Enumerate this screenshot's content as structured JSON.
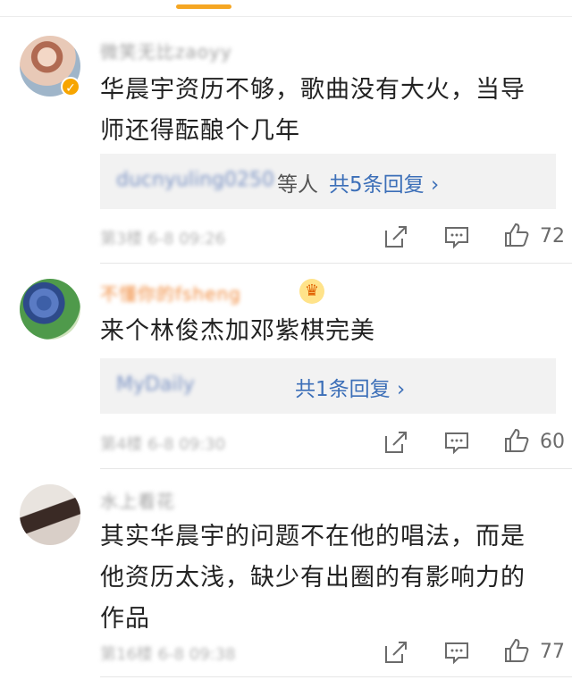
{
  "colors": {
    "accent": "#f5a623",
    "link": "#3c6fb8",
    "reply_bg": "#f2f2f2"
  },
  "comments": [
    {
      "username": "微笑无比zaoyy",
      "text_line1": "华晨宇资历不够，歌曲没有大火，当导",
      "text_line2": "师还得酝酿个几年",
      "reply_users": "ducnyuling0250",
      "reply_suffix": "等人",
      "reply_link": "共5条回复 ›",
      "meta": "第3楼 6-8 09:26",
      "likes": "72",
      "icons": [
        "verified-badge-icon",
        "share-icon",
        "comment-icon",
        "like-icon"
      ]
    },
    {
      "username": "不懂你的fsheng",
      "text_line1": "来个林俊杰加邓紫棋完美",
      "reply_users": "MyDaily",
      "reply_link": "共1条回复 ›",
      "meta": "第4楼 6-8 09:30",
      "likes": "60",
      "icons": [
        "crown-badge-icon",
        "share-icon",
        "comment-icon",
        "like-icon"
      ]
    },
    {
      "username": "水上看花",
      "text_line1": "其实华晨宇的问题不在他的唱法，而是",
      "text_line2": "他资历太浅，缺少有出圈的有影响力的",
      "text_line3": "作品",
      "meta": "第16楼 6-8 09:38",
      "likes": "77",
      "icons": [
        "share-icon",
        "comment-icon",
        "like-icon"
      ]
    }
  ]
}
